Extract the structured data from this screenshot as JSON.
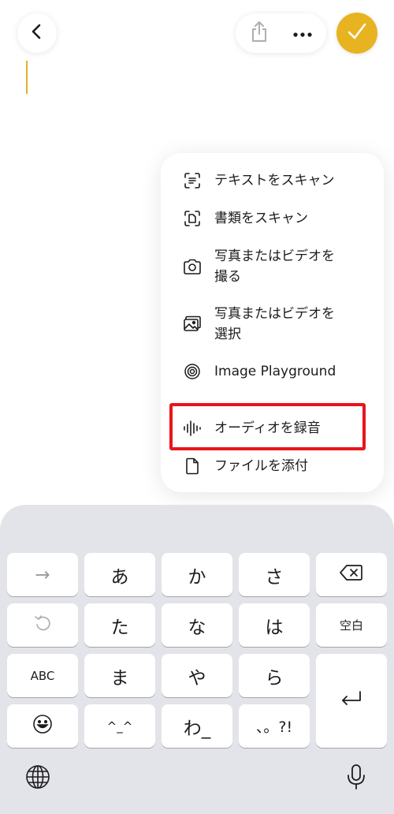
{
  "toolbar": {
    "back": "back-icon",
    "share": "share-icon",
    "more": "more-icon",
    "done": "checkmark-icon",
    "done_color": "#e7b320"
  },
  "menu": {
    "items": [
      {
        "label": "テキストをスキャン",
        "icon": "scan-text-icon"
      },
      {
        "label": "書類をスキャン",
        "icon": "scan-document-icon"
      },
      {
        "label_line1": "写真またはビデオを",
        "label_line2": "撮る",
        "icon": "camera-icon"
      },
      {
        "label_line1": "写真またはビデオを",
        "label_line2": "選択",
        "icon": "photo-library-icon"
      },
      {
        "label": "Image Playground",
        "icon": "image-playground-icon"
      },
      {
        "label": "オーディオを録音",
        "icon": "waveform-icon",
        "highlighted": true
      },
      {
        "label": "ファイルを添付",
        "icon": "document-icon"
      }
    ],
    "highlight_color": "#e8141c"
  },
  "keyboard": {
    "keys": {
      "arrow": "→",
      "a": "あ",
      "ka": "か",
      "sa": "さ",
      "ta": "た",
      "na": "な",
      "ha": "は",
      "space": "空白",
      "abc": "ABC",
      "ma": "ま",
      "ya": "や",
      "ra": "ら",
      "kaomoji": "^_^",
      "wa": "わ_",
      "punct": "、。?!"
    },
    "icons": [
      "undo-icon",
      "delete-icon",
      "return-icon",
      "emoji-icon",
      "globe-icon",
      "microphone-icon"
    ]
  }
}
